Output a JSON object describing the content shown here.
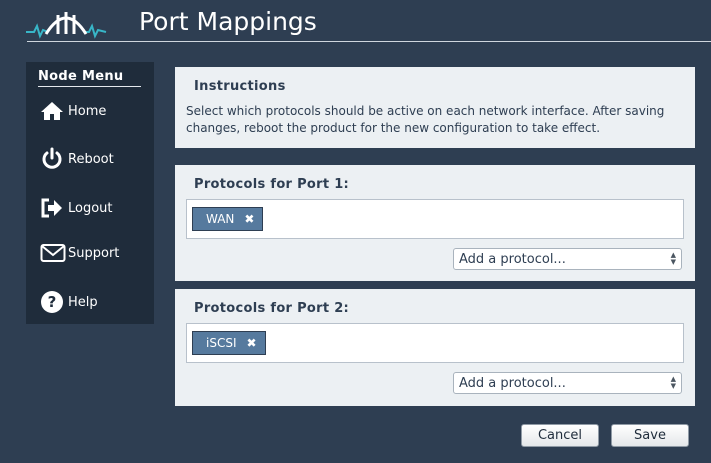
{
  "header": {
    "title": "Port Mappings",
    "logo_icon": "bridge-logo"
  },
  "sidebar": {
    "title": "Node Menu",
    "items": [
      {
        "label": "Home",
        "icon": "home-icon"
      },
      {
        "label": "Reboot",
        "icon": "power-icon"
      },
      {
        "label": "Logout",
        "icon": "logout-icon"
      },
      {
        "label": "Support",
        "icon": "envelope-icon"
      },
      {
        "label": "Help",
        "icon": "question-icon"
      }
    ]
  },
  "instructions": {
    "title": "Instructions",
    "text": "Select which protocols should be active on each network interface. After saving changes, reboot the product for the new configuration to take effect."
  },
  "ports": [
    {
      "title": "Protocols for Port 1:",
      "tags": [
        "WAN"
      ],
      "select_placeholder": "Add a protocol..."
    },
    {
      "title": "Protocols for Port 2:",
      "tags": [
        "iSCSI"
      ],
      "select_placeholder": "Add a protocol..."
    }
  ],
  "actions": {
    "cancel": "Cancel",
    "save": "Save"
  },
  "colors": {
    "background": "#2e3e52",
    "sidebar": "#1f2c3b",
    "panel": "#ecf0f3",
    "tag": "#567a9e",
    "logo_accent": "#38b6c8"
  }
}
